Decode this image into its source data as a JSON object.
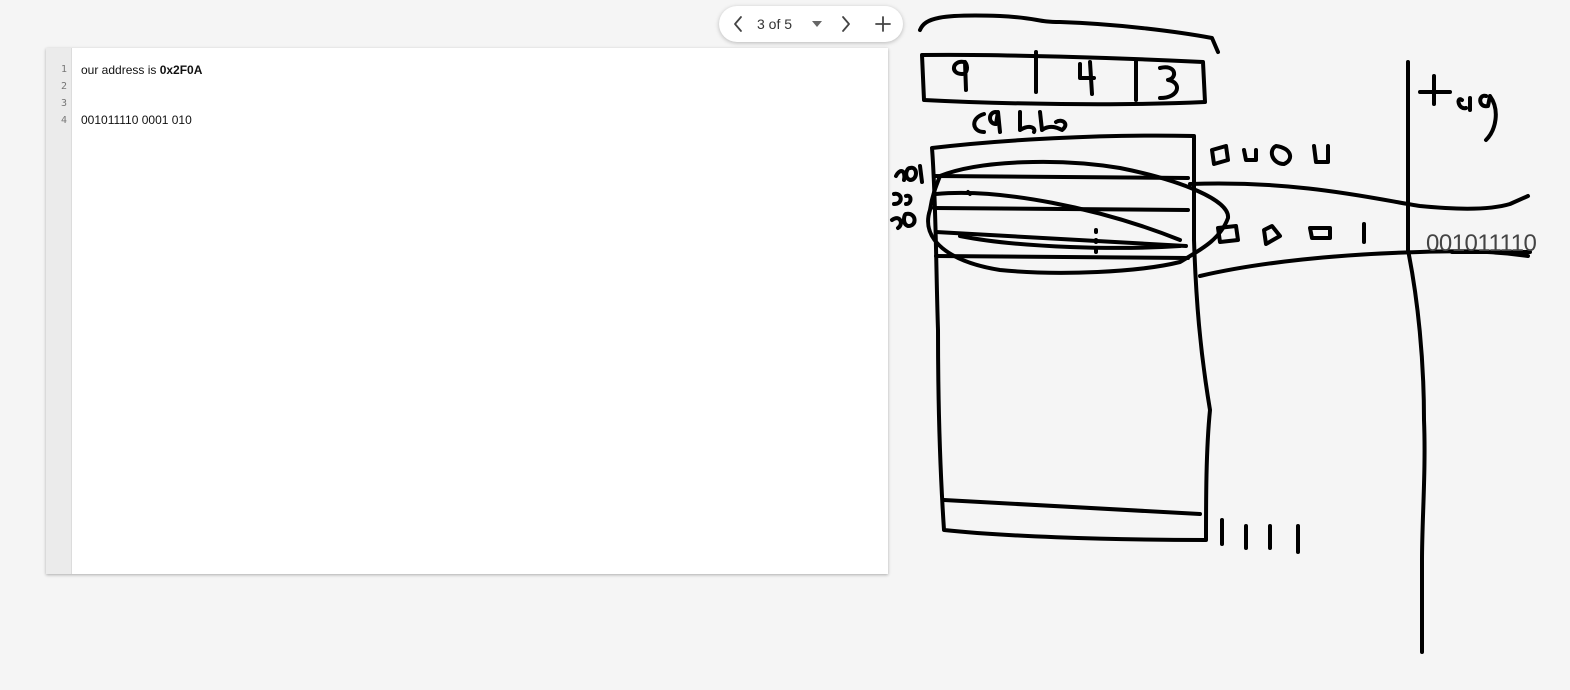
{
  "pager": {
    "prev_icon": "chevron-left-icon",
    "label": "3 of 5",
    "dropdown_icon": "caret-down-icon",
    "next_icon": "chevron-right-icon",
    "add_icon": "plus-icon"
  },
  "editor": {
    "lines": [
      {
        "num": "1",
        "text": "our address is ",
        "bold": "0x2F0A"
      },
      {
        "num": "2",
        "text": "",
        "bold": ""
      },
      {
        "num": "3",
        "text": "",
        "bold": ""
      },
      {
        "num": "4",
        "text": "001011110 0001 010",
        "bold": ""
      }
    ]
  },
  "canvas": {
    "typed_text": "001011110"
  }
}
